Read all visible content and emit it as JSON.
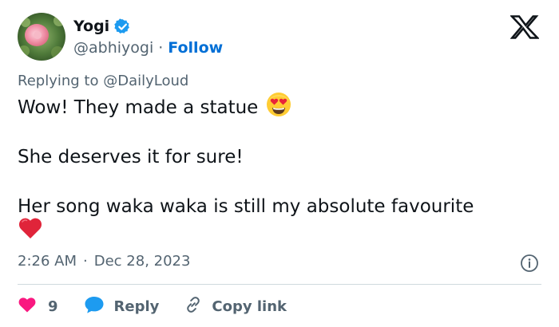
{
  "author": {
    "display_name": "Yogi",
    "handle": "@abhiyogi",
    "separator": "·",
    "follow_label": "Follow"
  },
  "reply_context": {
    "prefix": "Replying to",
    "mention": "@DailyLoud"
  },
  "tweet": {
    "line1": "Wow! They made a statue",
    "line2": "She deserves it for sure!",
    "line3": "Her song waka waka is still my absolute favourite"
  },
  "meta": {
    "time": "2:26 AM",
    "separator": "·",
    "date": "Dec 28, 2023"
  },
  "actions": {
    "like_count": "9",
    "reply_label": "Reply",
    "copy_label": "Copy link"
  },
  "icons": {
    "verified": "verified-badge-icon",
    "logo": "x-logo-icon",
    "heart_eyes": "heart-eyes-emoji",
    "heart": "red-heart-emoji",
    "info": "info-icon",
    "like": "heart-icon",
    "reply": "speech-bubble-icon",
    "copy": "link-icon"
  },
  "colors": {
    "text": "#0f1419",
    "secondary": "#536471",
    "link": "#006fd6",
    "verified": "#1d9bf0",
    "like": "#f91880",
    "divider": "#cfd9de"
  }
}
